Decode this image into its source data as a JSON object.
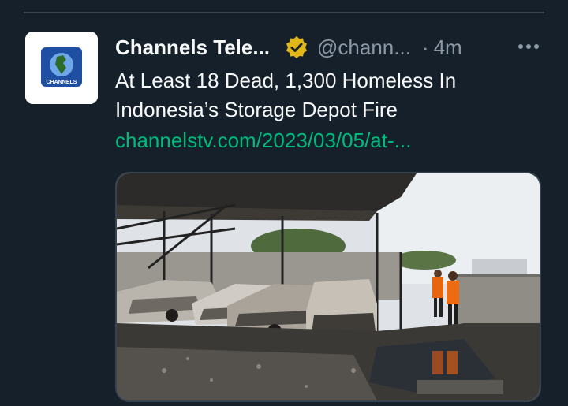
{
  "tweet": {
    "author_name": "Channels Tele...",
    "handle": "@chann...",
    "separator": "·",
    "time": "4m",
    "text": "At Least 18 Dead, 1,300 Homeless In Indonesia’s Storage Depot Fire",
    "link": "channelstv.com/2023/03/05/at-...",
    "avatar_text": "CHANNELS",
    "verified_color": "#e2b719",
    "link_color": "#00ba7c"
  },
  "icons": {
    "avatar": "channels-logo-icon",
    "verified": "verified-badge-icon",
    "more": "more-options-icon"
  }
}
